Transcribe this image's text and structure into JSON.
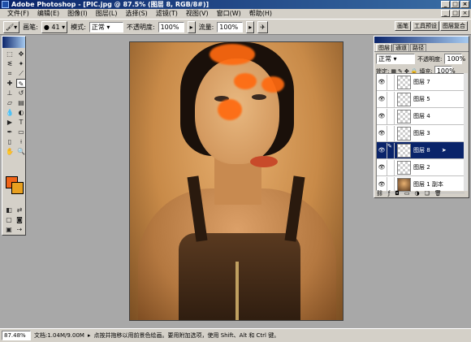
{
  "window": {
    "title": "Adobe Photoshop - [PIC.jpg @ 87.5% (图层 8, RGB/8#)]"
  },
  "menu": [
    "文件(F)",
    "编辑(E)",
    "图像(I)",
    "图层(L)",
    "选择(S)",
    "滤镜(T)",
    "视图(V)",
    "窗口(W)",
    "帮助(H)"
  ],
  "options": {
    "brush_label": "画笔:",
    "brush_size": "41",
    "mode_label": "模式:",
    "mode_value": "正常",
    "opacity_label": "不透明度:",
    "opacity_value": "100%",
    "flow_label": "流量:",
    "flow_value": "100%"
  },
  "palette_well": [
    "画笔",
    "工具预设",
    "图层复合"
  ],
  "layers_panel": {
    "tabs": [
      "图层",
      "通道",
      "路径"
    ],
    "blend_mode": "正常",
    "opacity_label": "不透明度:",
    "opacity_value": "100%",
    "lock_label": "锁定:",
    "fill_label": "填充:",
    "fill_value": "100%",
    "layers": [
      {
        "name": "图层 7",
        "selected": false,
        "visible": true
      },
      {
        "name": "图层 5",
        "selected": false,
        "visible": true
      },
      {
        "name": "图层 4",
        "selected": false,
        "visible": true
      },
      {
        "name": "图层 3",
        "selected": false,
        "visible": true
      },
      {
        "name": "图层 8",
        "selected": true,
        "visible": true
      },
      {
        "name": "图层 2",
        "selected": false,
        "visible": true
      },
      {
        "name": "图层 1 副本",
        "selected": false,
        "visible": true
      }
    ]
  },
  "status": {
    "zoom": "87.48%",
    "doc": "文档:1.04M/9.00M",
    "hint": "点按并拖移以用前景色绘画。要用附加选项，使用 Shift、Alt 和 Ctrl 键。"
  },
  "colors": {
    "foreground": "#f06418",
    "background": "#e8a020"
  }
}
